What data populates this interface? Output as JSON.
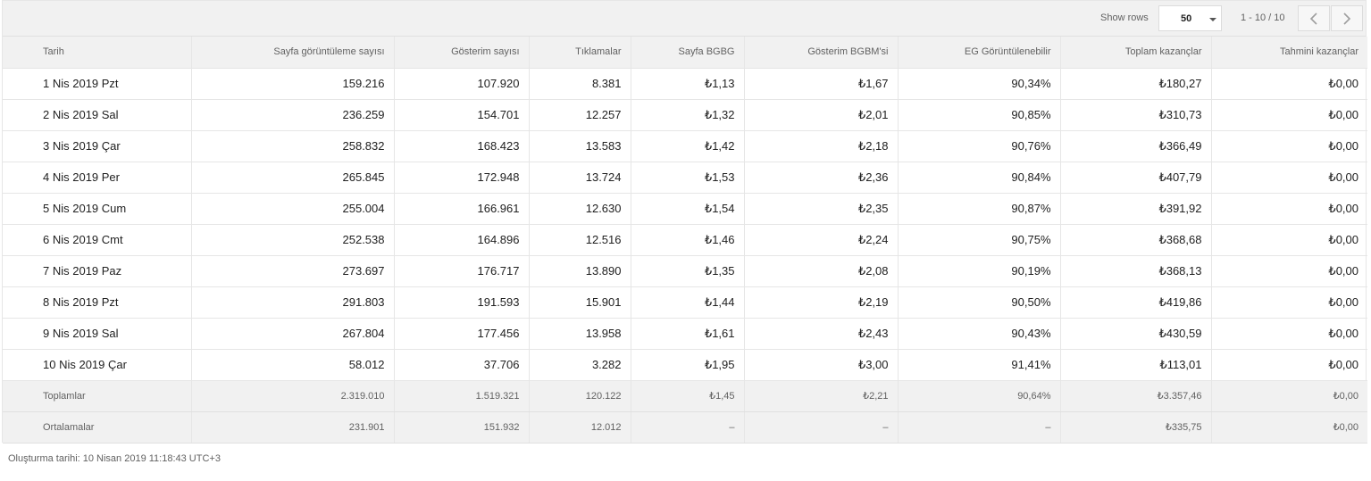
{
  "toolbar": {
    "show_rows_label": "Show rows",
    "rows_per_page": "50",
    "range_text": "1 - 10 / 10"
  },
  "table": {
    "columns": [
      "Tarih",
      "Sayfa görüntüleme sayısı",
      "Gösterim sayısı",
      "Tıklamalar",
      "Sayfa BGBG",
      "Gösterim BGBM'si",
      "EG Görüntülenebilir",
      "Toplam kazançlar",
      "Tahmini kazançlar"
    ],
    "rows": [
      [
        "1 Nis 2019 Pzt",
        "159.216",
        "107.920",
        "8.381",
        "₺1,13",
        "₺1,67",
        "90,34%",
        "₺180,27",
        "₺0,00"
      ],
      [
        "2 Nis 2019 Sal",
        "236.259",
        "154.701",
        "12.257",
        "₺1,32",
        "₺2,01",
        "90,85%",
        "₺310,73",
        "₺0,00"
      ],
      [
        "3 Nis 2019 Çar",
        "258.832",
        "168.423",
        "13.583",
        "₺1,42",
        "₺2,18",
        "90,76%",
        "₺366,49",
        "₺0,00"
      ],
      [
        "4 Nis 2019 Per",
        "265.845",
        "172.948",
        "13.724",
        "₺1,53",
        "₺2,36",
        "90,84%",
        "₺407,79",
        "₺0,00"
      ],
      [
        "5 Nis 2019 Cum",
        "255.004",
        "166.961",
        "12.630",
        "₺1,54",
        "₺2,35",
        "90,87%",
        "₺391,92",
        "₺0,00"
      ],
      [
        "6 Nis 2019 Cmt",
        "252.538",
        "164.896",
        "12.516",
        "₺1,46",
        "₺2,24",
        "90,75%",
        "₺368,68",
        "₺0,00"
      ],
      [
        "7 Nis 2019 Paz",
        "273.697",
        "176.717",
        "13.890",
        "₺1,35",
        "₺2,08",
        "90,19%",
        "₺368,13",
        "₺0,00"
      ],
      [
        "8 Nis 2019 Pzt",
        "291.803",
        "191.593",
        "15.901",
        "₺1,44",
        "₺2,19",
        "90,50%",
        "₺419,86",
        "₺0,00"
      ],
      [
        "9 Nis 2019 Sal",
        "267.804",
        "177.456",
        "13.958",
        "₺1,61",
        "₺2,43",
        "90,43%",
        "₺430,59",
        "₺0,00"
      ],
      [
        "10 Nis 2019 Çar",
        "58.012",
        "37.706",
        "3.282",
        "₺1,95",
        "₺3,00",
        "91,41%",
        "₺113,01",
        "₺0,00"
      ]
    ],
    "totals": [
      "Toplamlar",
      "2.319.010",
      "1.519.321",
      "120.122",
      "₺1,45",
      "₺2,21",
      "90,64%",
      "₺3.357,46",
      "₺0,00"
    ],
    "averages": [
      "Ortalamalar",
      "231.901",
      "151.932",
      "12.012",
      "–",
      "–",
      "–",
      "₺335,75",
      "₺0,00"
    ]
  },
  "footer": {
    "created_text": "Oluşturma tarihi: 10 Nisan 2019 11:18:43 UTC+3"
  },
  "icons": {
    "prev": "chevron-left-icon",
    "next": "chevron-right-icon",
    "dropdown": "caret-down-icon"
  }
}
